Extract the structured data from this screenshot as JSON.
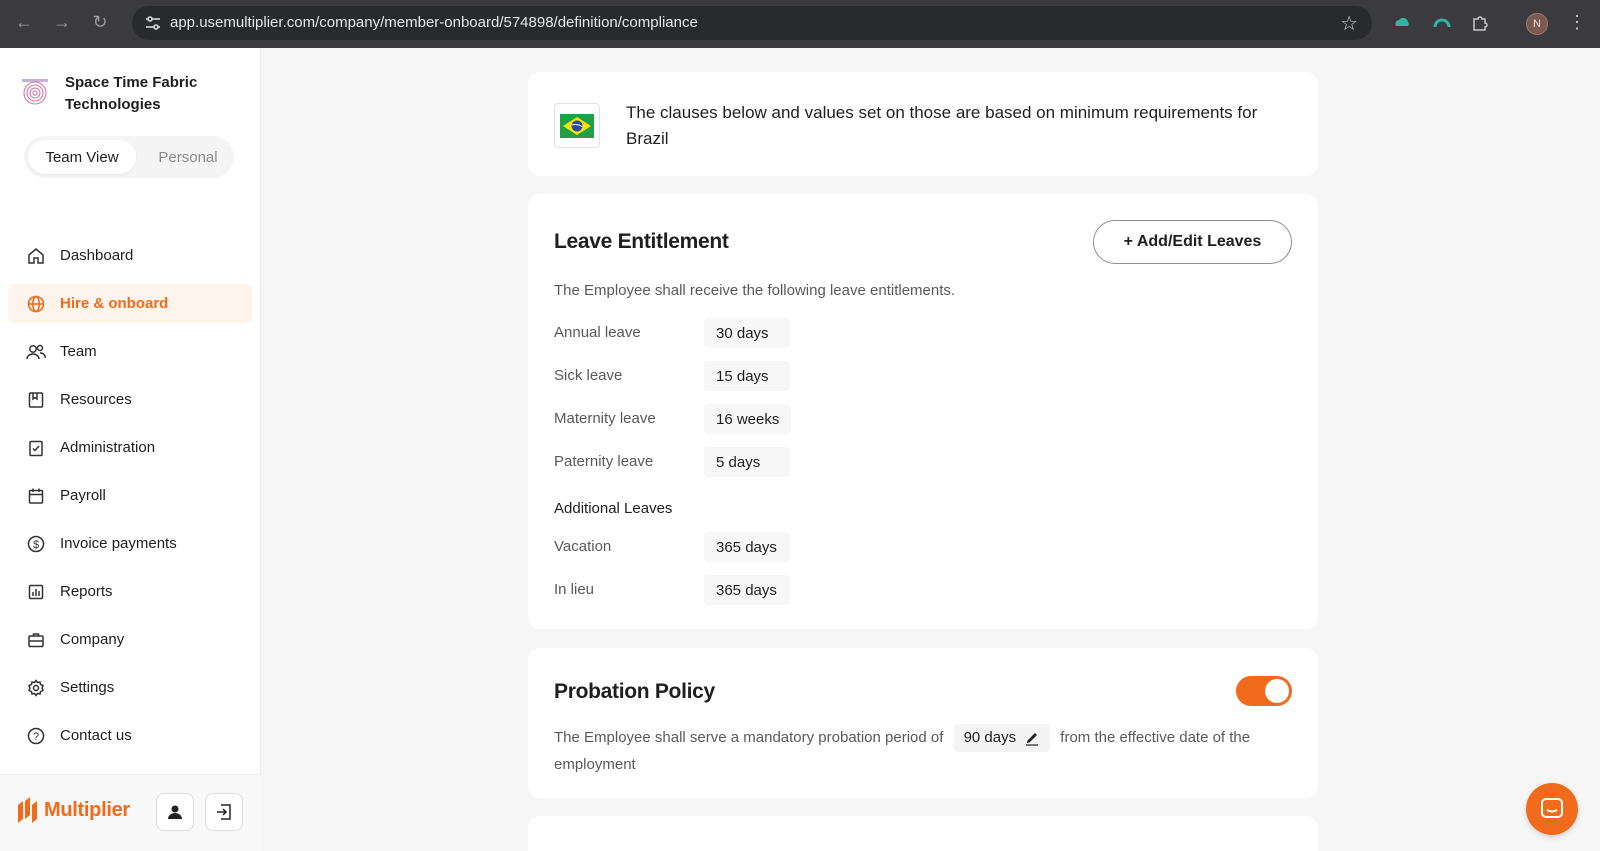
{
  "browser": {
    "url": "app.usemultiplier.com/company/member-onboard/574898/definition/compliance",
    "profile_initial": "N"
  },
  "sidebar": {
    "company_name": "Space Time Fabric Technologies",
    "view_toggle": {
      "team": "Team View",
      "personal": "Personal"
    },
    "items": [
      {
        "label": "Dashboard",
        "icon": "home-icon"
      },
      {
        "label": "Hire & onboard",
        "icon": "globe-icon",
        "active": true
      },
      {
        "label": "Team",
        "icon": "users-icon"
      },
      {
        "label": "Resources",
        "icon": "book-icon"
      },
      {
        "label": "Administration",
        "icon": "clipboard-check-icon"
      },
      {
        "label": "Payroll",
        "icon": "calendar-icon"
      },
      {
        "label": "Invoice payments",
        "icon": "dollar-icon"
      },
      {
        "label": "Reports",
        "icon": "bar-chart-icon"
      },
      {
        "label": "Company",
        "icon": "briefcase-icon"
      },
      {
        "label": "Settings",
        "icon": "gear-icon"
      },
      {
        "label": "Contact us",
        "icon": "help-icon"
      }
    ],
    "footer_brand": "Multiplier"
  },
  "country_card": {
    "text": "The clauses below and values set on those are based on minimum requirements for Brazil"
  },
  "leave_card": {
    "title": "Leave Entitlement",
    "add_button": "+ Add/Edit Leaves",
    "description": "The Employee shall receive the following leave entitlements.",
    "leaves": [
      {
        "label": "Annual leave",
        "value": "30 days"
      },
      {
        "label": "Sick leave",
        "value": "15 days"
      },
      {
        "label": "Maternity leave",
        "value": "16 weeks"
      },
      {
        "label": "Paternity leave",
        "value": "5 days"
      }
    ],
    "additional_title": "Additional Leaves",
    "additional": [
      {
        "label": "Vacation",
        "value": "365 days"
      },
      {
        "label": "In lieu",
        "value": "365 days"
      }
    ]
  },
  "probation_card": {
    "title": "Probation Policy",
    "enabled": true,
    "text_before": "The Employee shall serve a mandatory probation period of",
    "value": "90 days",
    "text_after": "from the effective date of the employment"
  },
  "colors": {
    "accent": "#f26a1b",
    "active_bg": "#fff4ec"
  }
}
